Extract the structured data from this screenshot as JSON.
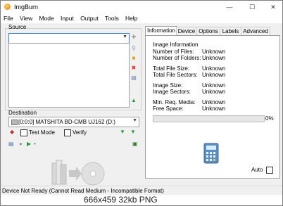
{
  "window": {
    "title": "ImgBurn"
  },
  "menu": [
    "File",
    "View",
    "Mode",
    "Input",
    "Output",
    "Tools",
    "Help"
  ],
  "source": {
    "label": "Source",
    "value": ""
  },
  "destination": {
    "label": "Destination",
    "drive": "[0:0:0] MATSHITA BD-CMB UJ162 (D:)",
    "test_mode": "Test Mode",
    "verify": "Verify"
  },
  "tabs": [
    {
      "label": "Information",
      "active": true
    },
    {
      "label": "Device"
    },
    {
      "label": "Options"
    },
    {
      "label": "Labels"
    },
    {
      "label": "Advanced"
    }
  ],
  "info": {
    "section_title": "Image Information",
    "rows": [
      {
        "label": "Number of Files:",
        "value": "Unknown"
      },
      {
        "label": "Number of Folders:",
        "value": "Unknown"
      },
      {
        "label": "Total File Size:",
        "value": "Unknown"
      },
      {
        "label": "Total File Sectors:",
        "value": "Unknown"
      },
      {
        "label": "Image Size:",
        "value": "Unknown"
      },
      {
        "label": "Image Sectors:",
        "value": "Unknown"
      },
      {
        "label": "Min. Req. Media:",
        "value": "Unknown"
      },
      {
        "label": "Free Space:",
        "value": "Unknown"
      }
    ],
    "progress_percent": 0,
    "progress_text": "0%",
    "auto_label": "Auto"
  },
  "status": {
    "text": "Device Not Ready (Cannot Read Medium - Incompatible Format)"
  },
  "caption": {
    "text": "666x459 32kb PNG"
  },
  "colors": {
    "accent": "#3a7bd5",
    "progress": "#06b025",
    "add": "#2e9a3a",
    "remove": "#d83a2a"
  }
}
